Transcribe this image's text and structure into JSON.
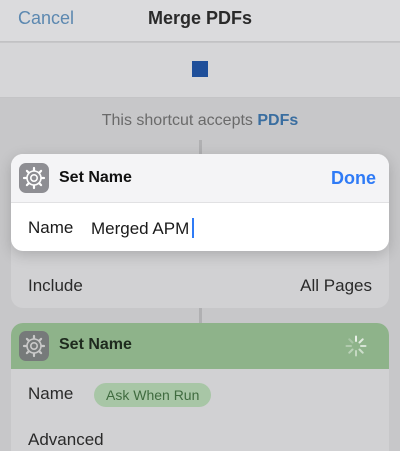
{
  "navbar": {
    "cancel_label": "Cancel",
    "title": "Merge PDFs"
  },
  "accepts": {
    "prefix": "This shortcut accepts",
    "type": "PDFs"
  },
  "set_name_card": {
    "title": "Set Name",
    "done_label": "Done",
    "name_label": "Name",
    "name_value": "Merged APM",
    "icon": "gear-icon"
  },
  "merge_card": {
    "include_label": "Include",
    "include_value": "All Pages"
  },
  "second_card": {
    "title": "Set Name",
    "icon": "gear-icon",
    "name_label": "Name",
    "name_chip": "Ask When Run",
    "advanced_label": "Advanced"
  },
  "colors": {
    "accent": "#2f7bf6",
    "stop": "#1f4f9a",
    "action_green": "#8eb38a"
  }
}
